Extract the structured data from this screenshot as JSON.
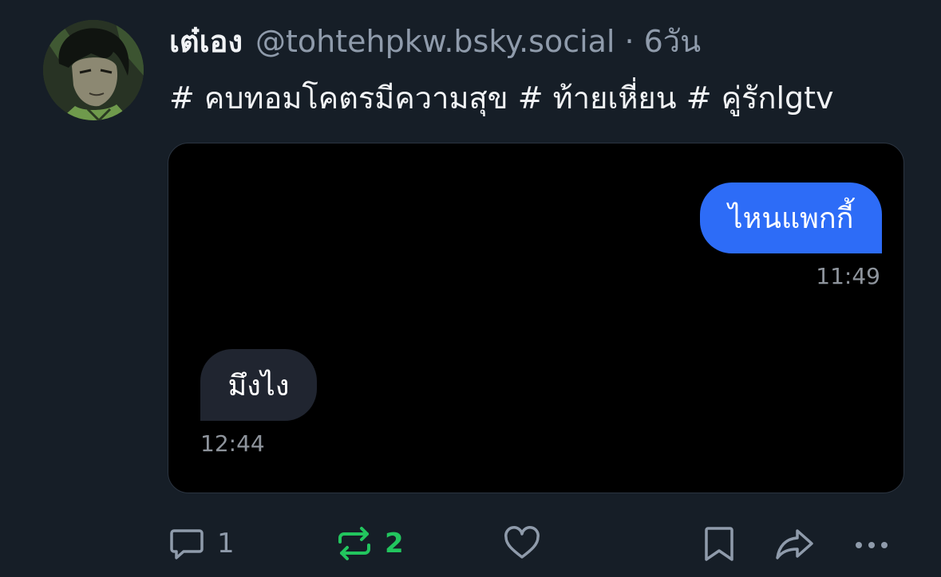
{
  "post": {
    "author": {
      "display_name": "เต๋เอง",
      "handle": "@tohtehpkw.bsky.social",
      "separator": "·",
      "time_ago": "6วัน",
      "avatar_icon": "anime-character-avatar"
    },
    "text": {
      "tag1": "# คบทอมโคตรมีความสุข",
      "tag2": "# ท้ายเหี่ยน",
      "tag3": "# คู่รักlgtv"
    },
    "embed": {
      "outgoing_message": "ไหนแพกกี้",
      "outgoing_time": "11:49",
      "incoming_message": "มึงไง",
      "incoming_time": "12:44"
    },
    "actions": {
      "reply_icon": "speech-bubble-icon",
      "reply_count": "1",
      "repost_icon": "repost-arrows-icon",
      "repost_count": "2",
      "like_icon": "heart-icon",
      "bookmark_icon": "bookmark-icon",
      "share_icon": "share-arrow-icon",
      "more_icon": "ellipsis-icon"
    },
    "colors": {
      "background": "#161e27",
      "muted_text": "#8f9bab",
      "repost_active": "#22c55e",
      "outgoing_bubble": "#2d6cf7",
      "incoming_bubble": "#202530"
    }
  }
}
